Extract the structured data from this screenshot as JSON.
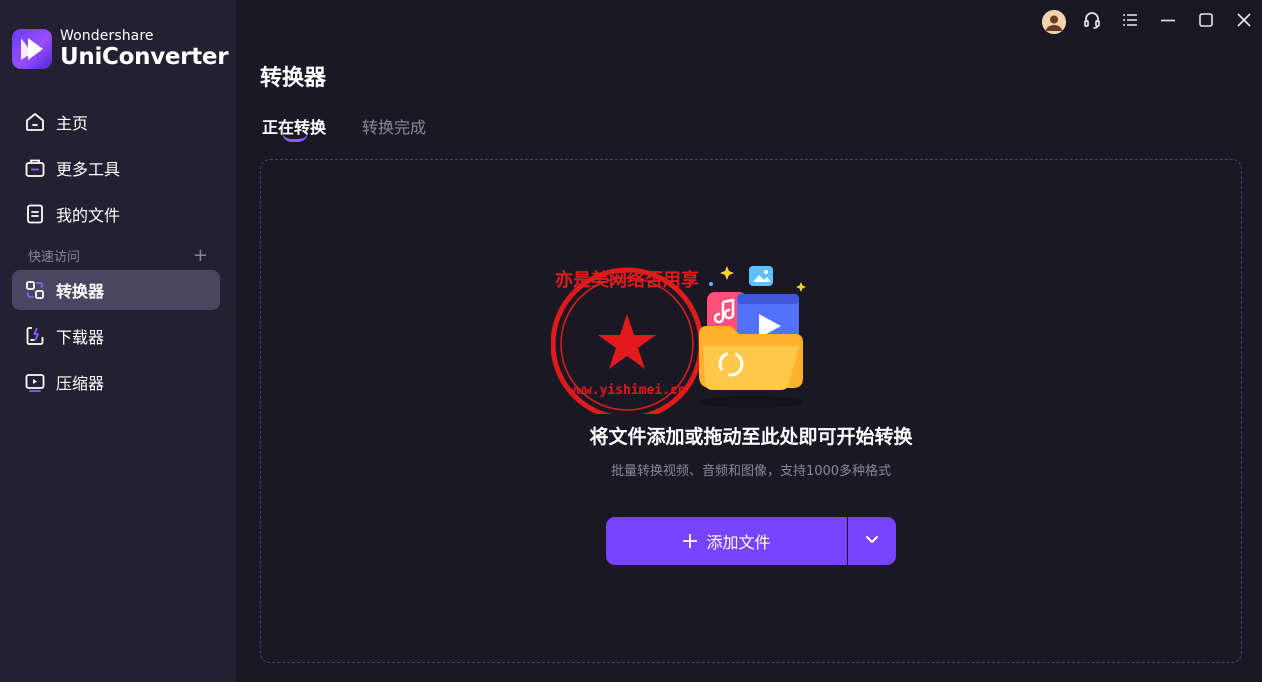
{
  "brand": {
    "small": "Wondershare",
    "name": "UniConverter"
  },
  "sidebar": {
    "items": [
      {
        "label": "主页",
        "icon": "home-icon"
      },
      {
        "label": "更多工具",
        "icon": "toolbox-icon"
      },
      {
        "label": "我的文件",
        "icon": "file-icon"
      }
    ],
    "quick_access": {
      "label": "快速访问",
      "add": "+"
    },
    "quick_items": [
      {
        "label": "转换器",
        "icon": "converter-icon",
        "active": true
      },
      {
        "label": "下载器",
        "icon": "downloader-icon",
        "active": false
      },
      {
        "label": "压缩器",
        "icon": "compressor-icon",
        "active": false
      }
    ]
  },
  "titlebar": {
    "icons": [
      "avatar-icon",
      "headset-icon",
      "menu-icon",
      "minimize-icon",
      "maximize-icon",
      "close-icon"
    ]
  },
  "main": {
    "title": "转换器",
    "tabs": [
      {
        "label": "正在转换",
        "active": true
      },
      {
        "label": "转换完成",
        "active": false
      }
    ],
    "dropzone": {
      "title": "将文件添加或拖动至此处即可开始转换",
      "subtitle": "批量转换视频、音频和图像，支持1000多种格式",
      "add_button": "添加文件"
    },
    "watermark": {
      "line1": "亦是美网络否用享",
      "url": "www.yishimei.cn"
    }
  },
  "colors": {
    "accent": "#7844ff",
    "sidebar_bg": "#232032",
    "main_bg": "#1b1826",
    "active_item": "#4a4560"
  }
}
